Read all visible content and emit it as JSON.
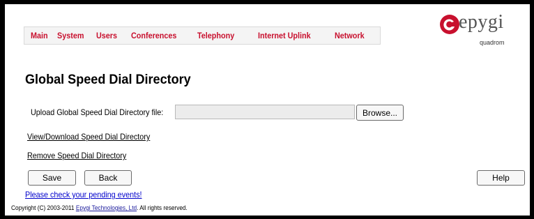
{
  "menu": {
    "items": [
      "Main",
      "System",
      "Users",
      "Conferences",
      "Telephony",
      "Internet Uplink",
      "Network"
    ]
  },
  "logo": {
    "brand": "epygi",
    "sub": "quadrom",
    "icon": "epygi-e-logo-icon",
    "color": "#c8102e"
  },
  "page": {
    "title": "Global Speed Dial Directory"
  },
  "upload": {
    "label": "Upload Global Speed Dial Directory file:",
    "value": "",
    "browse_label": "Browse..."
  },
  "links": {
    "view_download": "View/Download Speed Dial Directory",
    "remove": "Remove Speed Dial Directory",
    "pending": "Please check your pending events!"
  },
  "buttons": {
    "save": "Save",
    "back": "Back",
    "help": "Help"
  },
  "footer": {
    "prefix": "Copyright (C) 2003-2011 ",
    "company": "Epygi Technologies, Ltd",
    "suffix": ". All rights reserved."
  }
}
